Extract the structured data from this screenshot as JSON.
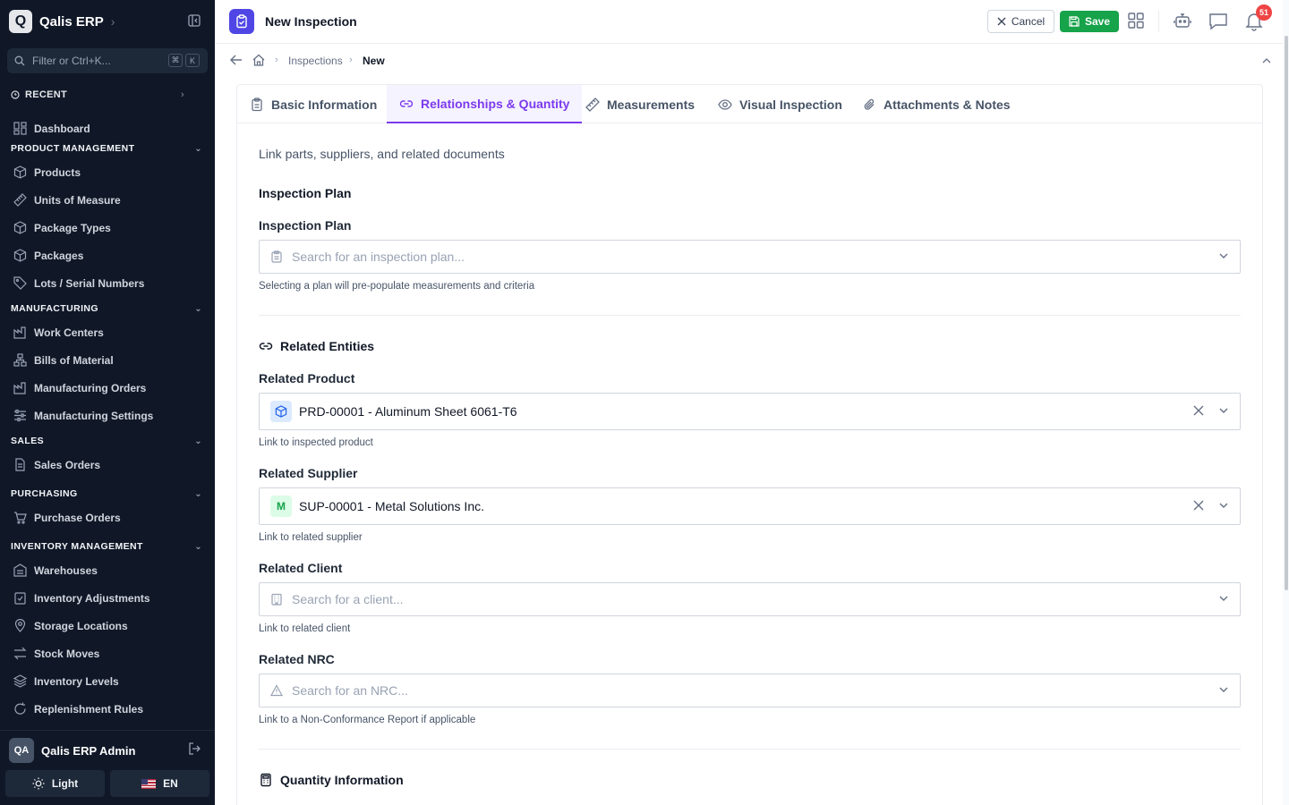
{
  "sidebar": {
    "app_name": "Qalis ERP",
    "logo_letter": "Q",
    "filter_placeholder": "Filter or Ctrl+K...",
    "kbd": [
      "⌘",
      "K"
    ],
    "recent_label": "RECENT",
    "dashboard_label": "Dashboard",
    "sections": [
      {
        "title": "PRODUCT MANAGEMENT",
        "items": [
          "Products",
          "Units of Measure",
          "Package Types",
          "Packages",
          "Lots / Serial Numbers"
        ]
      },
      {
        "title": "MANUFACTURING",
        "items": [
          "Work Centers",
          "Bills of Material",
          "Manufacturing Orders",
          "Manufacturing Settings"
        ]
      },
      {
        "title": "SALES",
        "items": [
          "Sales Orders"
        ]
      },
      {
        "title": "PURCHASING",
        "items": [
          "Purchase Orders"
        ]
      },
      {
        "title": "INVENTORY MANAGEMENT",
        "items": [
          "Warehouses",
          "Inventory Adjustments",
          "Storage Locations",
          "Stock Moves",
          "Inventory Levels",
          "Replenishment Rules"
        ]
      }
    ],
    "user": {
      "initials": "QA",
      "name": "Qalis ERP Admin"
    },
    "theme_label": "Light",
    "lang_label": "EN"
  },
  "header": {
    "title": "New Inspection",
    "cancel_label": "Cancel",
    "save_label": "Save",
    "notification_count": "51"
  },
  "breadcrumb": {
    "parent": "Inspections",
    "current": "New"
  },
  "tabs": [
    {
      "label": "Basic Information",
      "active": false
    },
    {
      "label": "Relationships & Quantity",
      "active": true
    },
    {
      "label": "Measurements",
      "active": false
    },
    {
      "label": "Visual Inspection",
      "active": false
    },
    {
      "label": "Attachments & Notes",
      "active": false
    }
  ],
  "form": {
    "subtitle": "Link parts, suppliers, and related documents",
    "plan_section": "Inspection Plan",
    "plan_label": "Inspection Plan",
    "plan_placeholder": "Search for an inspection plan...",
    "plan_help": "Selecting a plan will pre-populate measurements and criteria",
    "related_section": "Related Entities",
    "product_label": "Related Product",
    "product_value": "PRD-00001 - Aluminum Sheet 6061-T6",
    "product_help": "Link to inspected product",
    "supplier_label": "Related Supplier",
    "supplier_chip": "M",
    "supplier_value": "SUP-00001 - Metal Solutions Inc.",
    "supplier_help": "Link to related supplier",
    "client_label": "Related Client",
    "client_placeholder": "Search for a client...",
    "client_help": "Link to related client",
    "nrc_label": "Related NRC",
    "nrc_placeholder": "Search for an NRC...",
    "nrc_help": "Link to a Non-Conformance Report if applicable",
    "quantity_section": "Quantity Information"
  },
  "colors": {
    "sidebar_bg": "#101828",
    "accent": "#7c3aed",
    "save": "#16a34a",
    "page_icon": "#4f46e5",
    "badge": "#ef4444"
  }
}
